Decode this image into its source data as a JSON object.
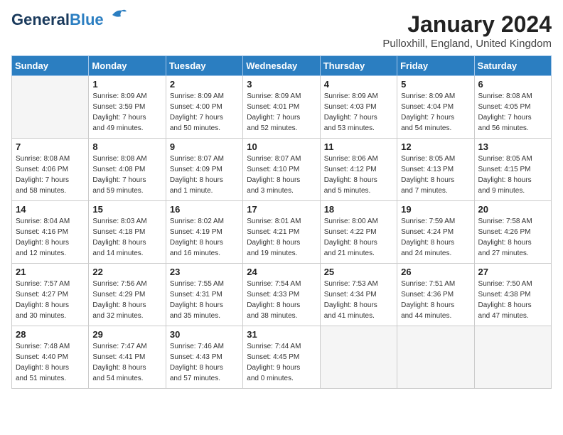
{
  "logo": {
    "line1": "General",
    "line2": "Blue",
    "bird_unicode": "🐦"
  },
  "title": "January 2024",
  "location": "Pulloxhill, England, United Kingdom",
  "days_of_week": [
    "Sunday",
    "Monday",
    "Tuesday",
    "Wednesday",
    "Thursday",
    "Friday",
    "Saturday"
  ],
  "weeks": [
    [
      {
        "day": "",
        "info": ""
      },
      {
        "day": "1",
        "info": "Sunrise: 8:09 AM\nSunset: 3:59 PM\nDaylight: 7 hours\nand 49 minutes."
      },
      {
        "day": "2",
        "info": "Sunrise: 8:09 AM\nSunset: 4:00 PM\nDaylight: 7 hours\nand 50 minutes."
      },
      {
        "day": "3",
        "info": "Sunrise: 8:09 AM\nSunset: 4:01 PM\nDaylight: 7 hours\nand 52 minutes."
      },
      {
        "day": "4",
        "info": "Sunrise: 8:09 AM\nSunset: 4:03 PM\nDaylight: 7 hours\nand 53 minutes."
      },
      {
        "day": "5",
        "info": "Sunrise: 8:09 AM\nSunset: 4:04 PM\nDaylight: 7 hours\nand 54 minutes."
      },
      {
        "day": "6",
        "info": "Sunrise: 8:08 AM\nSunset: 4:05 PM\nDaylight: 7 hours\nand 56 minutes."
      }
    ],
    [
      {
        "day": "7",
        "info": "Sunrise: 8:08 AM\nSunset: 4:06 PM\nDaylight: 7 hours\nand 58 minutes."
      },
      {
        "day": "8",
        "info": "Sunrise: 8:08 AM\nSunset: 4:08 PM\nDaylight: 7 hours\nand 59 minutes."
      },
      {
        "day": "9",
        "info": "Sunrise: 8:07 AM\nSunset: 4:09 PM\nDaylight: 8 hours\nand 1 minute."
      },
      {
        "day": "10",
        "info": "Sunrise: 8:07 AM\nSunset: 4:10 PM\nDaylight: 8 hours\nand 3 minutes."
      },
      {
        "day": "11",
        "info": "Sunrise: 8:06 AM\nSunset: 4:12 PM\nDaylight: 8 hours\nand 5 minutes."
      },
      {
        "day": "12",
        "info": "Sunrise: 8:05 AM\nSunset: 4:13 PM\nDaylight: 8 hours\nand 7 minutes."
      },
      {
        "day": "13",
        "info": "Sunrise: 8:05 AM\nSunset: 4:15 PM\nDaylight: 8 hours\nand 9 minutes."
      }
    ],
    [
      {
        "day": "14",
        "info": "Sunrise: 8:04 AM\nSunset: 4:16 PM\nDaylight: 8 hours\nand 12 minutes."
      },
      {
        "day": "15",
        "info": "Sunrise: 8:03 AM\nSunset: 4:18 PM\nDaylight: 8 hours\nand 14 minutes."
      },
      {
        "day": "16",
        "info": "Sunrise: 8:02 AM\nSunset: 4:19 PM\nDaylight: 8 hours\nand 16 minutes."
      },
      {
        "day": "17",
        "info": "Sunrise: 8:01 AM\nSunset: 4:21 PM\nDaylight: 8 hours\nand 19 minutes."
      },
      {
        "day": "18",
        "info": "Sunrise: 8:00 AM\nSunset: 4:22 PM\nDaylight: 8 hours\nand 21 minutes."
      },
      {
        "day": "19",
        "info": "Sunrise: 7:59 AM\nSunset: 4:24 PM\nDaylight: 8 hours\nand 24 minutes."
      },
      {
        "day": "20",
        "info": "Sunrise: 7:58 AM\nSunset: 4:26 PM\nDaylight: 8 hours\nand 27 minutes."
      }
    ],
    [
      {
        "day": "21",
        "info": "Sunrise: 7:57 AM\nSunset: 4:27 PM\nDaylight: 8 hours\nand 30 minutes."
      },
      {
        "day": "22",
        "info": "Sunrise: 7:56 AM\nSunset: 4:29 PM\nDaylight: 8 hours\nand 32 minutes."
      },
      {
        "day": "23",
        "info": "Sunrise: 7:55 AM\nSunset: 4:31 PM\nDaylight: 8 hours\nand 35 minutes."
      },
      {
        "day": "24",
        "info": "Sunrise: 7:54 AM\nSunset: 4:33 PM\nDaylight: 8 hours\nand 38 minutes."
      },
      {
        "day": "25",
        "info": "Sunrise: 7:53 AM\nSunset: 4:34 PM\nDaylight: 8 hours\nand 41 minutes."
      },
      {
        "day": "26",
        "info": "Sunrise: 7:51 AM\nSunset: 4:36 PM\nDaylight: 8 hours\nand 44 minutes."
      },
      {
        "day": "27",
        "info": "Sunrise: 7:50 AM\nSunset: 4:38 PM\nDaylight: 8 hours\nand 47 minutes."
      }
    ],
    [
      {
        "day": "28",
        "info": "Sunrise: 7:48 AM\nSunset: 4:40 PM\nDaylight: 8 hours\nand 51 minutes."
      },
      {
        "day": "29",
        "info": "Sunrise: 7:47 AM\nSunset: 4:41 PM\nDaylight: 8 hours\nand 54 minutes."
      },
      {
        "day": "30",
        "info": "Sunrise: 7:46 AM\nSunset: 4:43 PM\nDaylight: 8 hours\nand 57 minutes."
      },
      {
        "day": "31",
        "info": "Sunrise: 7:44 AM\nSunset: 4:45 PM\nDaylight: 9 hours\nand 0 minutes."
      },
      {
        "day": "",
        "info": ""
      },
      {
        "day": "",
        "info": ""
      },
      {
        "day": "",
        "info": ""
      }
    ]
  ]
}
